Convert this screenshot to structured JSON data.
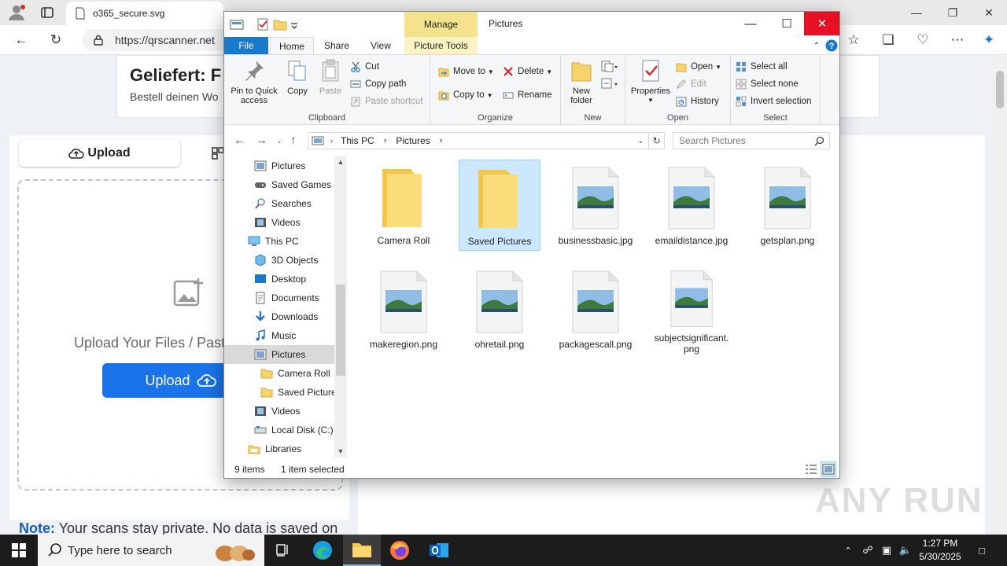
{
  "browser": {
    "tabs": [
      {
        "label": "o365_secure.svg",
        "active": true
      },
      {
        "label": "",
        "active": false
      },
      {
        "label": "",
        "active": false
      }
    ],
    "url": "https://qrscanner.net"
  },
  "page": {
    "ad_title": "Geliefert: F",
    "ad_subtitle": "Bestell deinen Wo",
    "tab_upload_label": "Upload",
    "dropzone_text": "Upload Your Files / Paste",
    "upload_button_label": "Upload",
    "note_label": "Note:",
    "note_text": " Your scans stay private. No data is saved on"
  },
  "explorer": {
    "manage_tab": "Manage",
    "title": "Pictures",
    "ribbon_tabs": [
      "File",
      "Home",
      "Share",
      "View",
      "Picture Tools"
    ],
    "ribbon": {
      "clipboard": {
        "label": "Clipboard",
        "pin": "Pin to Quick access",
        "copy": "Copy",
        "paste": "Paste",
        "cut": "Cut",
        "copy_path": "Copy path",
        "paste_shortcut": "Paste shortcut"
      },
      "organize": {
        "label": "Organize",
        "move_to": "Move to",
        "copy_to": "Copy to",
        "delete": "Delete",
        "rename": "Rename"
      },
      "new": {
        "label": "New",
        "new_folder": "New folder"
      },
      "open": {
        "label": "Open",
        "properties": "Properties",
        "open": "Open",
        "edit": "Edit",
        "history": "History"
      },
      "select": {
        "label": "Select",
        "select_all": "Select all",
        "select_none": "Select none",
        "invert": "Invert selection"
      }
    },
    "address": {
      "crumbs": [
        "This PC",
        "Pictures"
      ],
      "search_placeholder": "Search Pictures"
    },
    "nav_items": [
      {
        "label": "Pictures",
        "icon": "pictures-icon",
        "indent": 1,
        "selected": false
      },
      {
        "label": "Saved Games",
        "icon": "saved-games-icon",
        "indent": 1,
        "selected": false
      },
      {
        "label": "Searches",
        "icon": "searches-icon",
        "indent": 1,
        "selected": false
      },
      {
        "label": "Videos",
        "icon": "videos-icon",
        "indent": 1,
        "selected": false
      },
      {
        "label": "This PC",
        "icon": "this-pc-icon",
        "indent": 0,
        "selected": false
      },
      {
        "label": "3D Objects",
        "icon": "3d-objects-icon",
        "indent": 1,
        "selected": false
      },
      {
        "label": "Desktop",
        "icon": "desktop-icon",
        "indent": 1,
        "selected": false
      },
      {
        "label": "Documents",
        "icon": "documents-icon",
        "indent": 1,
        "selected": false
      },
      {
        "label": "Downloads",
        "icon": "downloads-icon",
        "indent": 1,
        "selected": false
      },
      {
        "label": "Music",
        "icon": "music-icon",
        "indent": 1,
        "selected": false
      },
      {
        "label": "Pictures",
        "icon": "pictures-icon",
        "indent": 1,
        "selected": true
      },
      {
        "label": "Camera Roll",
        "icon": "folder-icon",
        "indent": 2,
        "selected": false
      },
      {
        "label": "Saved Pictures",
        "icon": "folder-icon",
        "indent": 2,
        "selected": false
      },
      {
        "label": "Videos",
        "icon": "videos-icon",
        "indent": 1,
        "selected": false
      },
      {
        "label": "Local Disk (C:)",
        "icon": "local-disk-icon",
        "indent": 1,
        "selected": false
      },
      {
        "label": "Libraries",
        "icon": "libraries-icon",
        "indent": 0,
        "selected": false
      }
    ],
    "files": [
      {
        "name": "Camera Roll",
        "kind": "folder",
        "selected": false
      },
      {
        "name": "Saved Pictures",
        "kind": "folder",
        "selected": true
      },
      {
        "name": "businessbasic.jpg",
        "kind": "image",
        "selected": false
      },
      {
        "name": "emaildistance.jpg",
        "kind": "image",
        "selected": false
      },
      {
        "name": "getsplan.png",
        "kind": "image",
        "selected": false
      },
      {
        "name": "makeregion.png",
        "kind": "image",
        "selected": false
      },
      {
        "name": "ohretail.png",
        "kind": "image",
        "selected": false
      },
      {
        "name": "packagescall.png",
        "kind": "image",
        "selected": false
      },
      {
        "name": "subjectsignificant.png",
        "kind": "image",
        "selected": false
      }
    ],
    "status": {
      "items": "9 items",
      "selection": "1 item selected"
    }
  },
  "taskbar": {
    "search_placeholder": "Type here to search",
    "time": "1:27 PM",
    "date": "5/30/2025"
  },
  "watermark": "ANY RUN",
  "colors": {
    "accent": "#1979ca",
    "close_red": "#e81123",
    "upload_blue": "#1a73e8",
    "manage_yellow": "#f4e38c",
    "selection": "#cce8ff"
  }
}
